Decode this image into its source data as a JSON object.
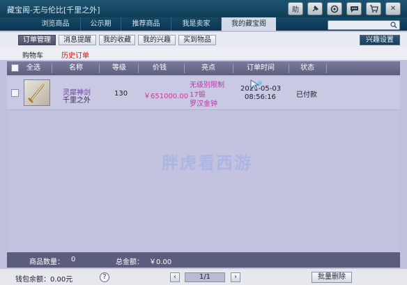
{
  "window": {
    "title": "藏宝阁-无与伦比[千里之外]"
  },
  "titlebar_icons": [
    "assist-icon",
    "pin-icon",
    "circle-icon",
    "chat-icon",
    "cart-icon",
    "close-icon"
  ],
  "titlebar_labels": {
    "assist": "助",
    "close": "✕"
  },
  "nav": {
    "tabs": [
      "浏览商品",
      "公示期",
      "推荐商品",
      "我是卖家",
      "我的藏宝阁"
    ],
    "active": "我的藏宝阁"
  },
  "search": {
    "placeholder": ""
  },
  "subtabs": {
    "items": [
      "订单管理",
      "消息提醒",
      "我的收藏",
      "我的兴趣",
      "买到物品"
    ],
    "active": "订单管理"
  },
  "interest_settings_label": "兴趣设置",
  "sublinks": {
    "cart": "购物车",
    "history": "历史订单"
  },
  "table": {
    "headers": {
      "select_all": "全选",
      "name": "名称",
      "level": "等级",
      "price": "价钱",
      "highlights": "亮点",
      "order_time": "订单时间",
      "status": "状态"
    },
    "rows": [
      {
        "name_line1": "灵犀神剑",
        "name_line2": "千里之外",
        "level": "130",
        "price": "￥651000.00",
        "highlight_line1": "无级别限制",
        "highlight_line2": "17锻",
        "highlight_line3": "罗汉金钟",
        "date": "2021-05-03",
        "time": "08:56:16",
        "status": "已付款"
      }
    ]
  },
  "watermark": "胖虎看西游",
  "summary": {
    "count_label": "商品数量：",
    "count_value": "0",
    "total_label": "总金额：",
    "total_value": "￥0.00"
  },
  "footer": {
    "wallet_label": "钱包余额：",
    "wallet_value": "0.00元",
    "help": "?",
    "prev": "‹",
    "page": "1/1",
    "next": "›",
    "batch_delete": "批量删除"
  },
  "colors": {
    "titlebar": "#164866",
    "price": "#c43c98",
    "highlight": "#b53aa3",
    "header": "#6b6c8d",
    "body": "#c3c3df"
  }
}
